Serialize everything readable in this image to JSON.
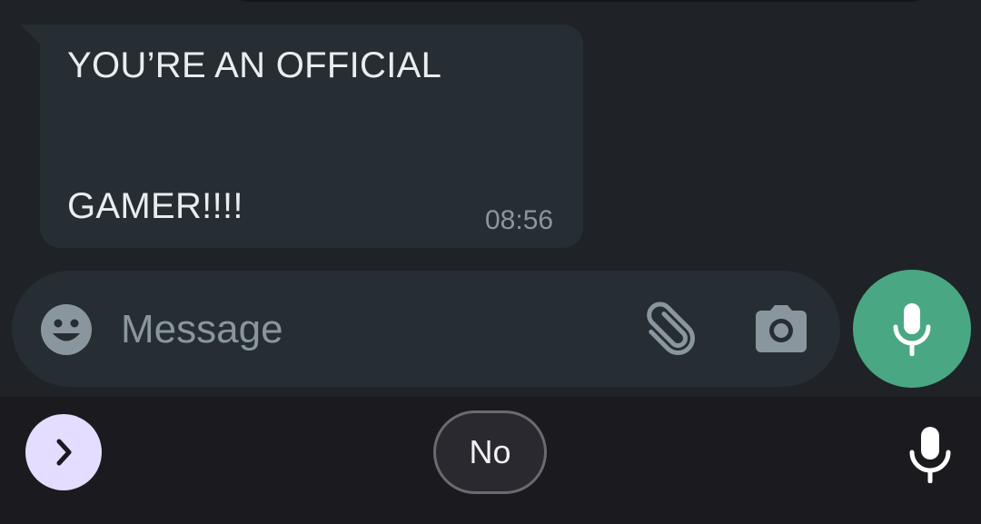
{
  "conversation": {
    "incoming_message": {
      "line1": "YOU’RE AN OFFICIAL",
      "line2": "GAMER!!!!",
      "time": "08:56"
    }
  },
  "composer": {
    "placeholder": "Message",
    "value": "",
    "icons": {
      "emoji": "emoji-icon",
      "attach": "paperclip-icon",
      "camera": "camera-icon",
      "voice": "microphone-icon"
    },
    "accent_color": "#4aa783"
  },
  "keyboard_toolbar": {
    "suggestion": "No",
    "expand_icon": "chevron-right-icon",
    "voice_icon": "microphone-icon",
    "expand_color": "#e4ddff"
  }
}
